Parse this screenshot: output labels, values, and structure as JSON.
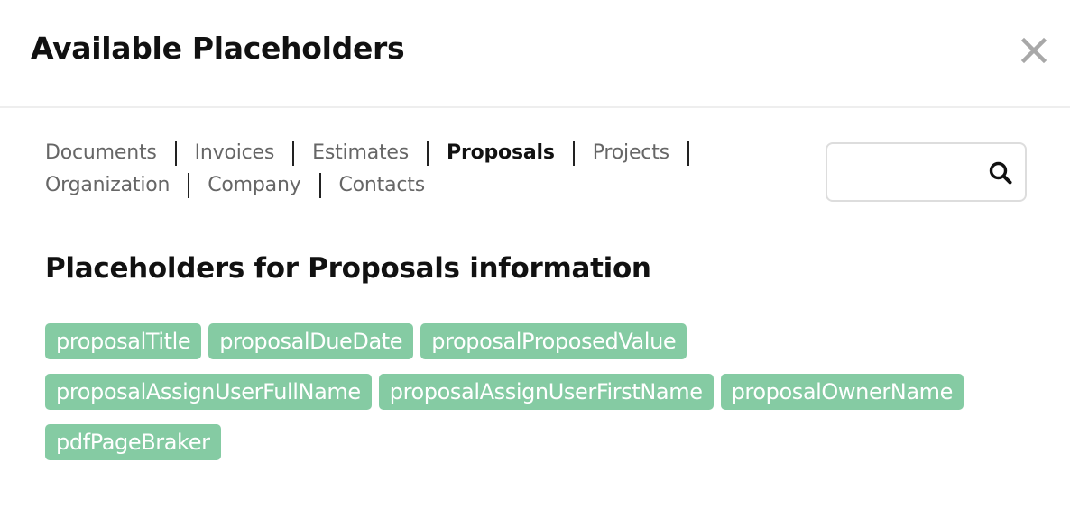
{
  "modal": {
    "title": "Available Placeholders"
  },
  "tabs": [
    {
      "label": "Documents",
      "active": false
    },
    {
      "label": "Invoices",
      "active": false
    },
    {
      "label": "Estimates",
      "active": false
    },
    {
      "label": "Proposals",
      "active": true
    },
    {
      "label": "Projects",
      "active": false
    },
    {
      "label": "Organization",
      "active": false
    },
    {
      "label": "Company",
      "active": false
    },
    {
      "label": "Contacts",
      "active": false
    }
  ],
  "search": {
    "value": "",
    "placeholder": "",
    "icon": "search-icon"
  },
  "section": {
    "heading": "Placeholders for Proposals information"
  },
  "placeholders": [
    "proposalTitle",
    "proposalDueDate",
    "proposalProposedValue",
    "proposalAssignUserFullName",
    "proposalAssignUserFirstName",
    "proposalOwnerName",
    "pdfPageBraker"
  ],
  "colors": {
    "chip_background": "#85cba3",
    "chip_text": "#ffffff",
    "active_tab": "#111111",
    "inactive_tab": "#666666"
  }
}
